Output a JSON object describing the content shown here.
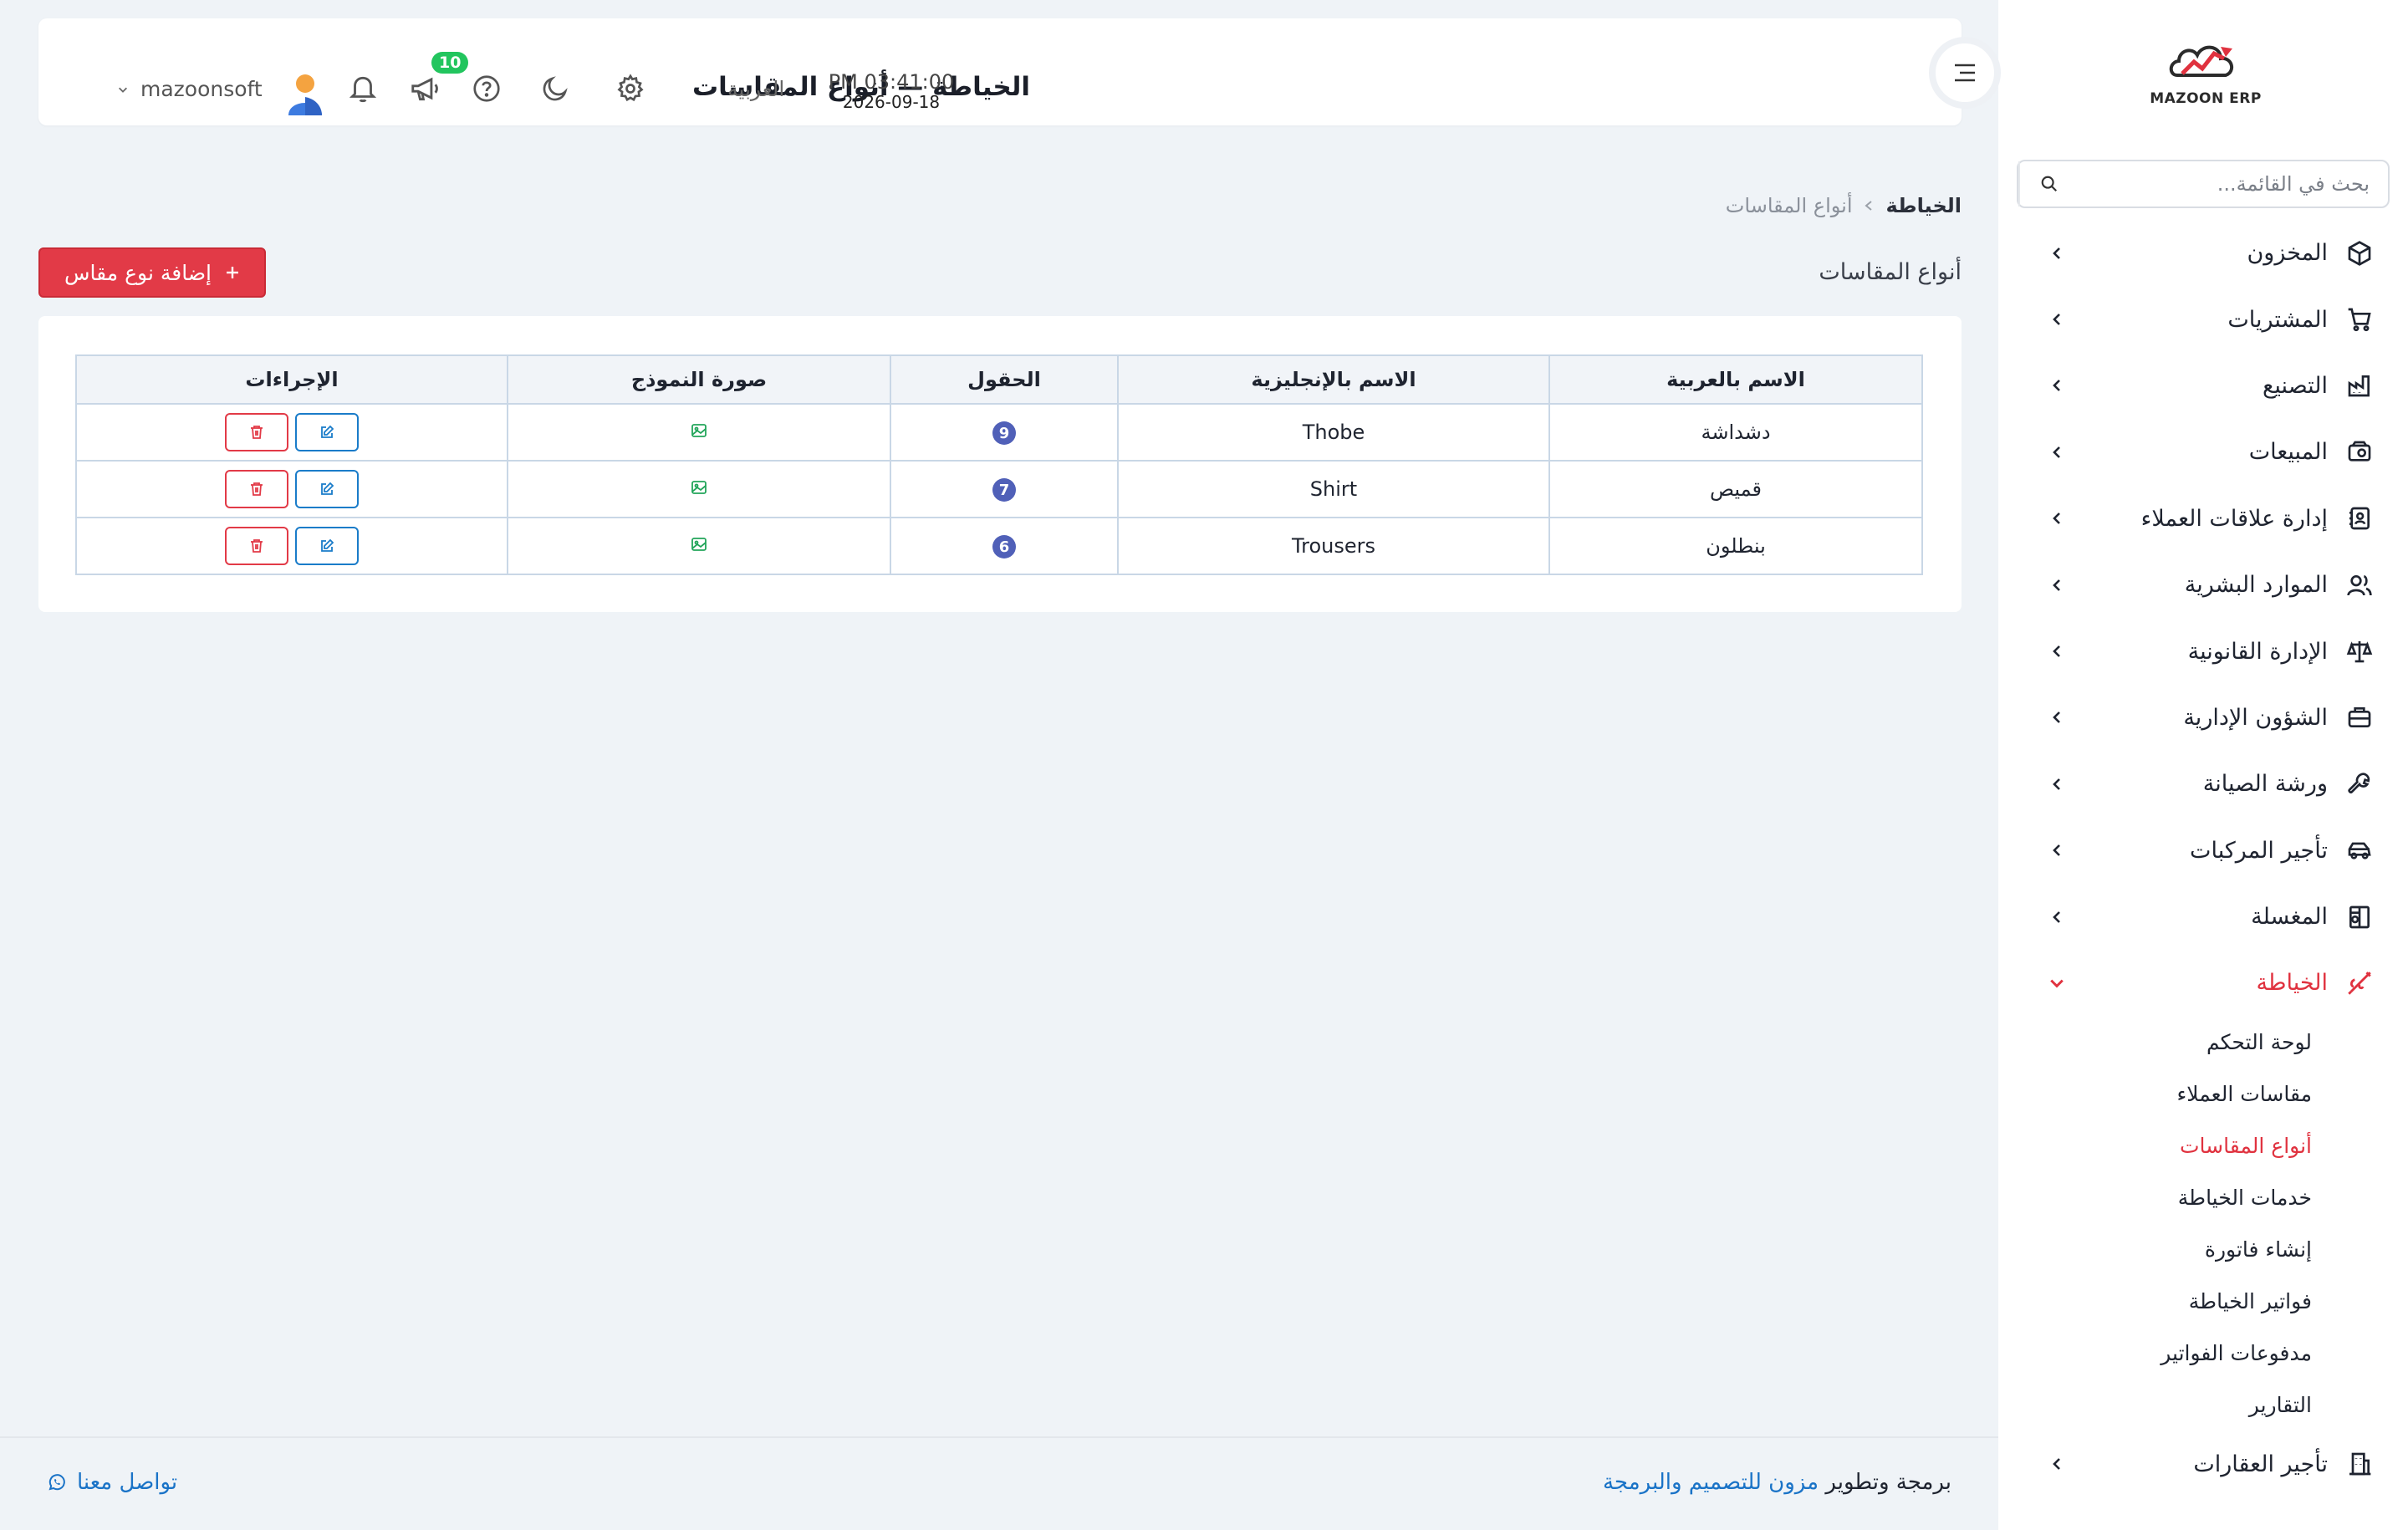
{
  "header": {
    "title": "الخياطة — أنواع المقاسات",
    "time": "PM 03:41:00",
    "date": "2026-09-18",
    "language": "العربية",
    "notification_count": "10",
    "username": "mazoonsoft"
  },
  "logo": {
    "text": "MAZOON ERP",
    "tagline": "ERP مزون"
  },
  "sidebar": {
    "search_placeholder": "بحث في القائمة...",
    "items": [
      {
        "label": "المخزون",
        "icon": "box-icon"
      },
      {
        "label": "المشتريات",
        "icon": "cart-icon"
      },
      {
        "label": "التصنيع",
        "icon": "factory-icon"
      },
      {
        "label": "المبيعات",
        "icon": "register-icon"
      },
      {
        "label": "إدارة علاقات العملاء",
        "icon": "contacts-icon"
      },
      {
        "label": "الموارد البشرية",
        "icon": "users-icon"
      },
      {
        "label": "الإدارة القانونية",
        "icon": "scale-icon"
      },
      {
        "label": "الشؤون الإدارية",
        "icon": "briefcase-icon"
      },
      {
        "label": "ورشة الصيانة",
        "icon": "wrench-icon"
      },
      {
        "label": "تأجير المركبات",
        "icon": "car-icon"
      },
      {
        "label": "المغسلة",
        "icon": "washer-icon"
      },
      {
        "label": "الخياطة",
        "icon": "needle-icon",
        "active": true
      },
      {
        "label": "تأجير العقارات",
        "icon": "building-icon"
      }
    ],
    "tailoring_submenu": [
      "لوحة التحكم",
      "مقاسات العملاء",
      "أنواع المقاسات",
      "خدمات الخياطة",
      "إنشاء فاتورة",
      "فواتير الخياطة",
      "مدفوعات الفواتير",
      "التقارير"
    ],
    "active_submenu": "أنواع المقاسات"
  },
  "breadcrumb": {
    "root": "الخياطة",
    "current": "أنواع المقاسات"
  },
  "section_title": "أنواع المقاسات",
  "add_button": "إضافة نوع مقاس",
  "table": {
    "headers": [
      "الاسم بالعربية",
      "الاسم بالإنجليزية",
      "الحقول",
      "صورة النموذج",
      "الإجراءات"
    ],
    "rows": [
      {
        "ar": "دشداشة",
        "en": "Thobe",
        "fields": "9"
      },
      {
        "ar": "قميص",
        "en": "Shirt",
        "fields": "7"
      },
      {
        "ar": "بنطلون",
        "en": "Trousers",
        "fields": "6"
      }
    ]
  },
  "footer": {
    "credit_prefix": "برمجة وتطوير",
    "credit_brand": "مزون للتصميم والبرمجة",
    "contact": "تواصل معنا"
  },
  "colors": {
    "accent_red": "#e23a47",
    "link_blue": "#1a73c7",
    "badge_green": "#22c55e",
    "count_indigo": "#5060b8"
  }
}
